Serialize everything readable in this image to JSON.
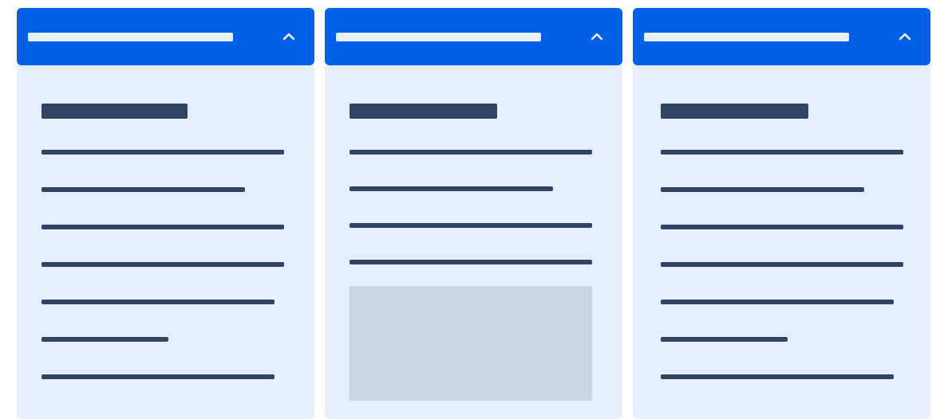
{
  "colors": {
    "header_bg": "#0061e6",
    "header_text_bar": "#e8f0fe",
    "body_bg": "#e5eefd",
    "heading_bar": "#2f4563",
    "line_bar": "#2f4563",
    "placeholder_block": "#cbd5e4",
    "chevron": "#ffffff"
  },
  "panels": [
    {
      "header_label": "",
      "toggle_icon": "chevron-up-icon",
      "heading": "",
      "lines": [
        "",
        "",
        "",
        "",
        "",
        "",
        ""
      ]
    },
    {
      "header_label": "",
      "toggle_icon": "chevron-up-icon",
      "heading": "",
      "lines": [
        "",
        "",
        "",
        ""
      ],
      "has_image_placeholder": true
    },
    {
      "header_label": "",
      "toggle_icon": "chevron-up-icon",
      "heading": "",
      "lines": [
        "",
        "",
        "",
        "",
        "",
        "",
        ""
      ]
    }
  ]
}
